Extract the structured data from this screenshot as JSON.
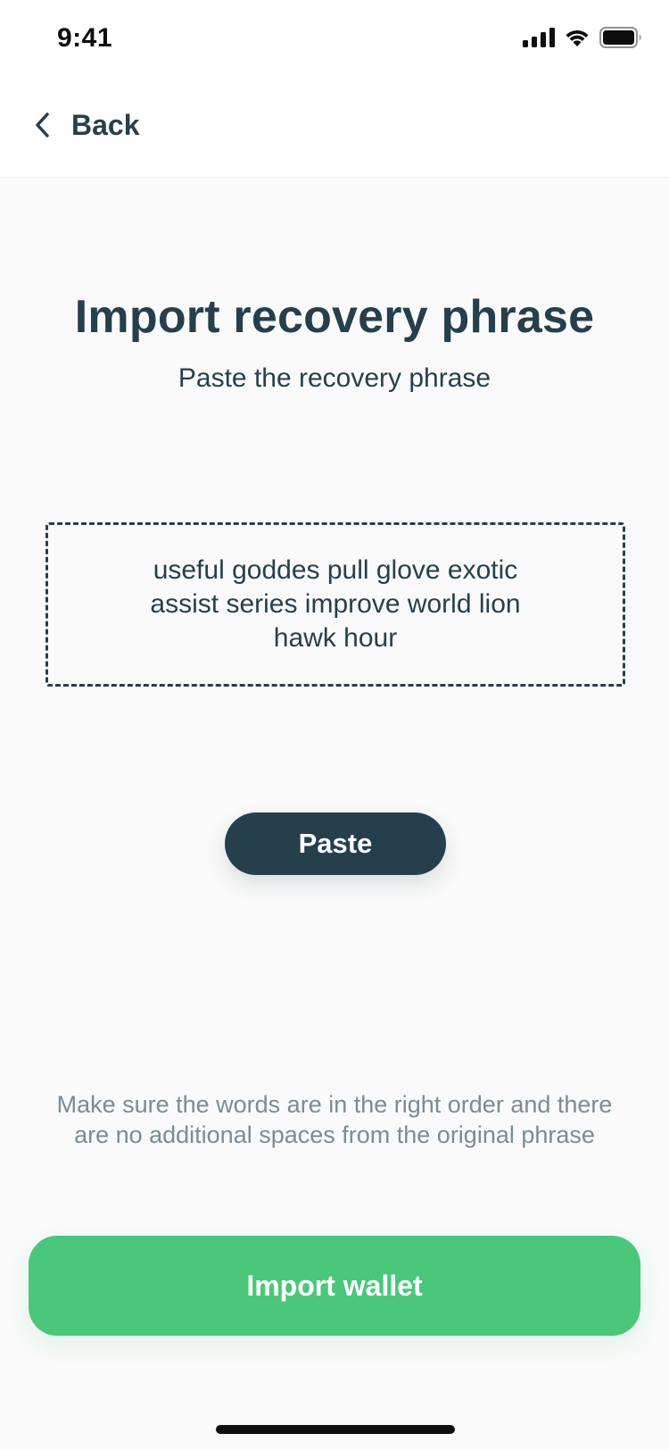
{
  "status_bar": {
    "time": "9:41",
    "icons": [
      "signal-icon",
      "wifi-icon",
      "battery-icon"
    ]
  },
  "header": {
    "back_label": "Back",
    "back_icon": "chevron-left-icon"
  },
  "main": {
    "title": "Import recovery phrase",
    "subtitle": "Paste the recovery phrase",
    "phrase": "useful goddes pull glove exotic assist series improve world lion hawk hour",
    "paste_label": "Paste",
    "hint": "Make sure the words are in the right order and there are no additional spaces from the original phrase",
    "import_label": "Import wallet"
  },
  "colors": {
    "primary_dark": "#263f4d",
    "accent_green": "#4bc77b",
    "muted_text": "#7c8b94",
    "background": "#fafafa"
  }
}
